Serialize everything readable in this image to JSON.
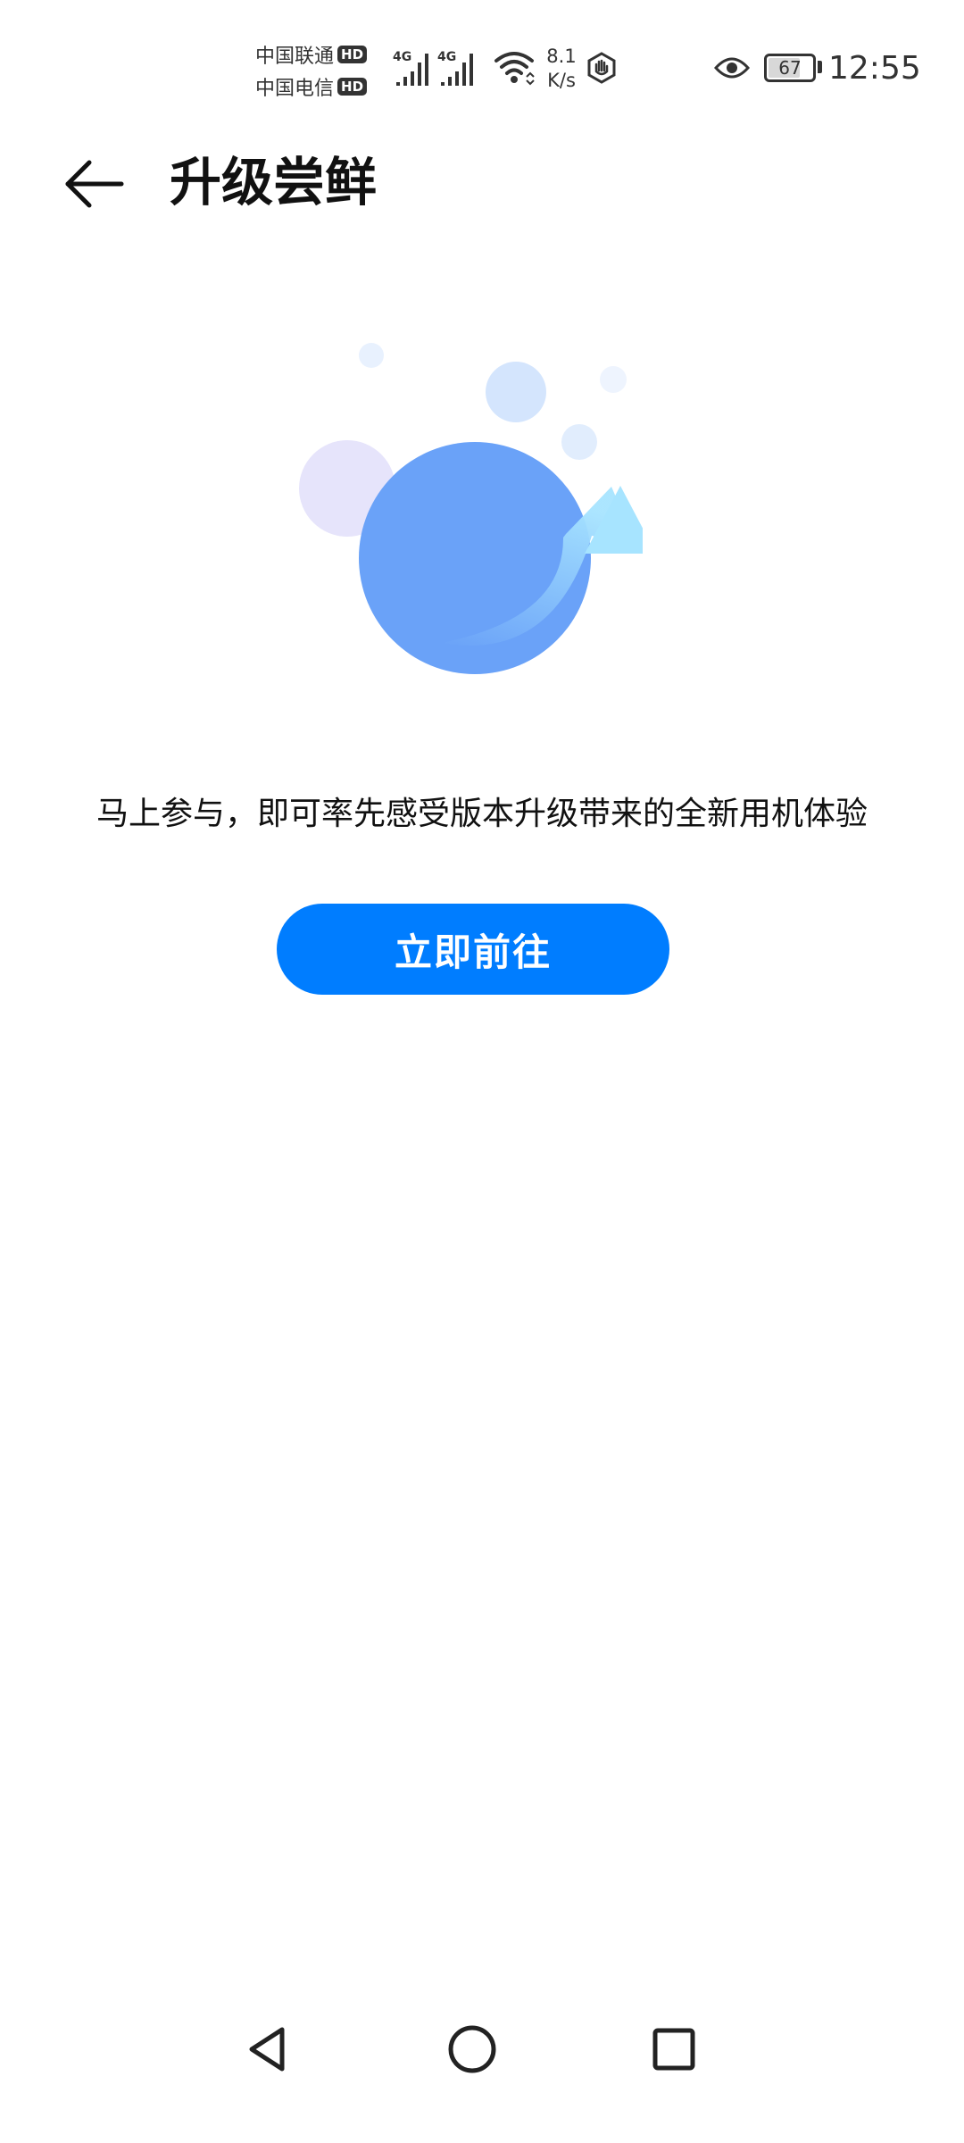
{
  "status_bar": {
    "carrier_1": "中国联通",
    "carrier_2": "中国电信",
    "hd_label": "HD",
    "network_type": "4G",
    "speed_value": "8.1",
    "speed_unit": "K/s",
    "battery_level": "67",
    "time": "12:55"
  },
  "app_bar": {
    "back_icon": "arrow-left-icon",
    "title": "升级尝鲜"
  },
  "illustration": {
    "icon": "upgrade-arrow-illustration",
    "colors": {
      "main_circle": "#6aa2f8",
      "arrow_light": "#a7e4ff",
      "lavender_bubble": "#e6e4fb",
      "small_bubble": "#d4e5fd"
    }
  },
  "main": {
    "description": "马上参与，即可率先感受版本升级带来的全新用机体验",
    "button_label": "立即前往"
  },
  "nav_bar": {
    "back_icon": "triangle-back-icon",
    "home_icon": "circle-home-icon",
    "recents_icon": "square-recents-icon"
  },
  "colors": {
    "accent": "#007dff",
    "background": "#ffffff",
    "text": "#111111"
  }
}
